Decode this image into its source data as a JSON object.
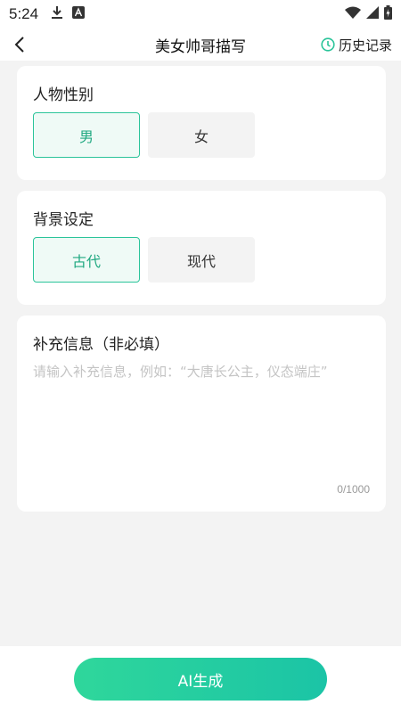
{
  "status_bar": {
    "time": "5:24",
    "icons": [
      "download-icon",
      "notification-a-icon",
      "wifi-icon",
      "signal-icon",
      "battery-icon"
    ]
  },
  "header": {
    "title": "美女帅哥描写",
    "history_label": "历史记录",
    "accent_color": "#2bc49a"
  },
  "gender": {
    "title": "人物性别",
    "options": [
      {
        "label": "男",
        "selected": true
      },
      {
        "label": "女",
        "selected": false
      }
    ]
  },
  "background": {
    "title": "背景设定",
    "options": [
      {
        "label": "古代",
        "selected": true
      },
      {
        "label": "现代",
        "selected": false
      }
    ]
  },
  "extra_info": {
    "title": "补充信息（非必填）",
    "placeholder": "请输入补充信息，例如：“大唐长公主，仪态端庄”",
    "value": "",
    "counter": "0/1000"
  },
  "actions": {
    "generate_label": "AI生成"
  }
}
